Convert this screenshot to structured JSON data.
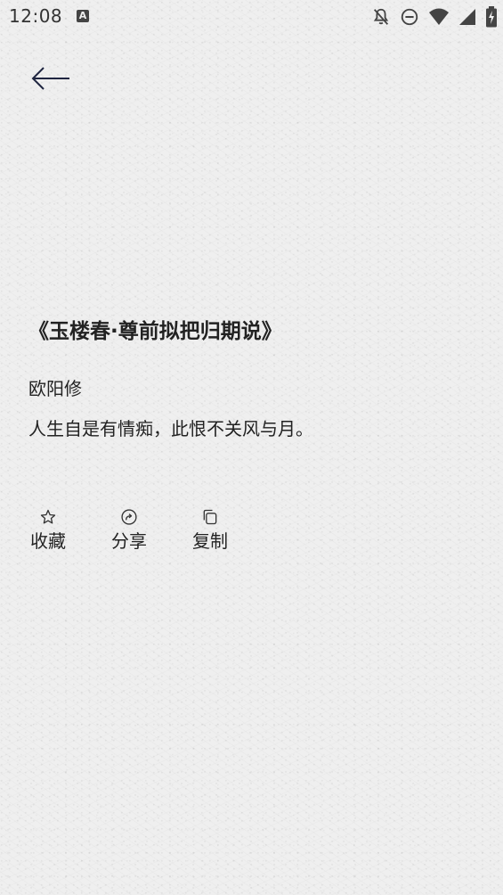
{
  "status_bar": {
    "time": "12:08",
    "a_badge": "A",
    "icons": [
      "notifications-off-icon",
      "do-not-disturb-icon",
      "wifi-icon",
      "cell-signal-icon",
      "battery-charging-icon"
    ]
  },
  "nav": {
    "back_icon": "arrow-left-icon"
  },
  "poem": {
    "title": "《玉楼春·尊前拟把归期说》",
    "author": "欧阳修",
    "line": "人生自是有情痴，此恨不关风与月。"
  },
  "actions": [
    {
      "label": "收藏",
      "icon": "star-outline-icon"
    },
    {
      "label": "分享",
      "icon": "share-circle-icon"
    },
    {
      "label": "复制",
      "icon": "copy-icon"
    }
  ],
  "colors": {
    "background": "#efefef",
    "text": "#222222",
    "back_arrow": "#1f2540"
  }
}
